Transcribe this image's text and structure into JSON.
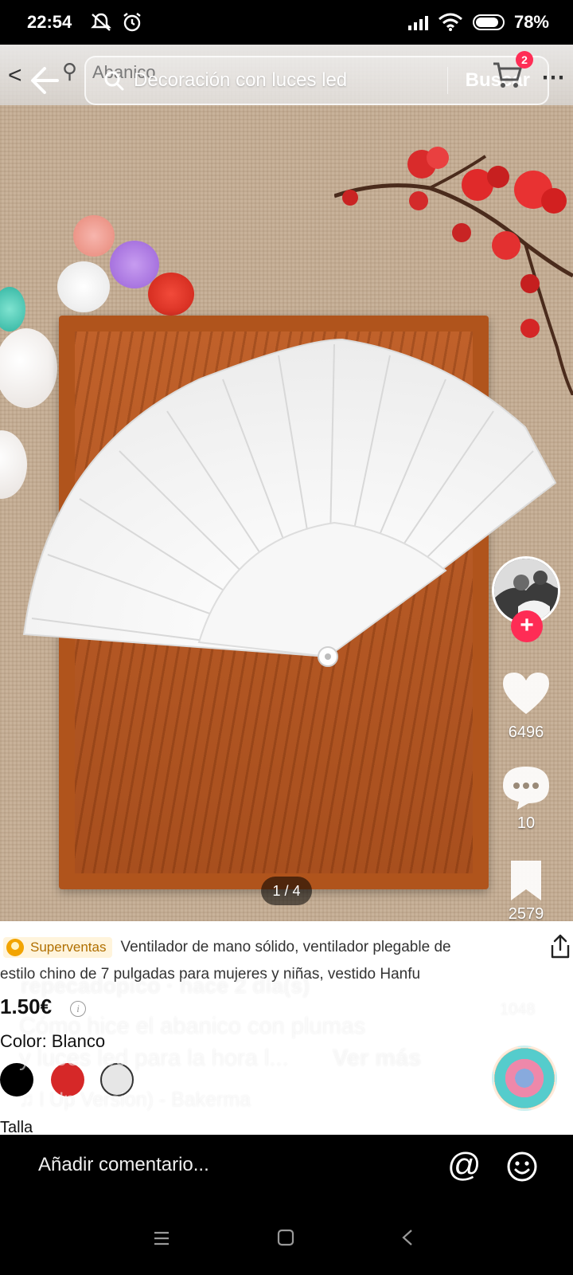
{
  "status_bar": {
    "time": "22:54",
    "battery": "78%"
  },
  "search": {
    "underlying_query": "Abanico",
    "query": "Decoración con luces led",
    "button": "Buscar",
    "cart_count": "2"
  },
  "media": {
    "page_indicator": "1 / 4"
  },
  "actions": {
    "likes": "6496",
    "comments": "10",
    "saves": "2579",
    "shares": "1048"
  },
  "product": {
    "badge": "Superventas",
    "title_line1": "Ventilador de mano sólido, ventilador plegable de",
    "title_line2": "estilo chino de 7 pulgadas para mujeres y niñas, vestido Hanfu",
    "price": "1.50€",
    "color_label": "Color: Blanco",
    "swatches": [
      "#000000",
      "#d62828",
      "#e6e6e6"
    ],
    "size_label": "Talla"
  },
  "caption": {
    "author": "repecadopico",
    "time_ago": "· hace 2 día(s)",
    "line1": "Cómo hice el abanico con plumas",
    "line2": "y luces led para la hora l...",
    "more": "Ver más",
    "music": "♫ l Up Version) - Bakerma"
  },
  "comment_bar": {
    "placeholder": "Añadir comentario..."
  }
}
